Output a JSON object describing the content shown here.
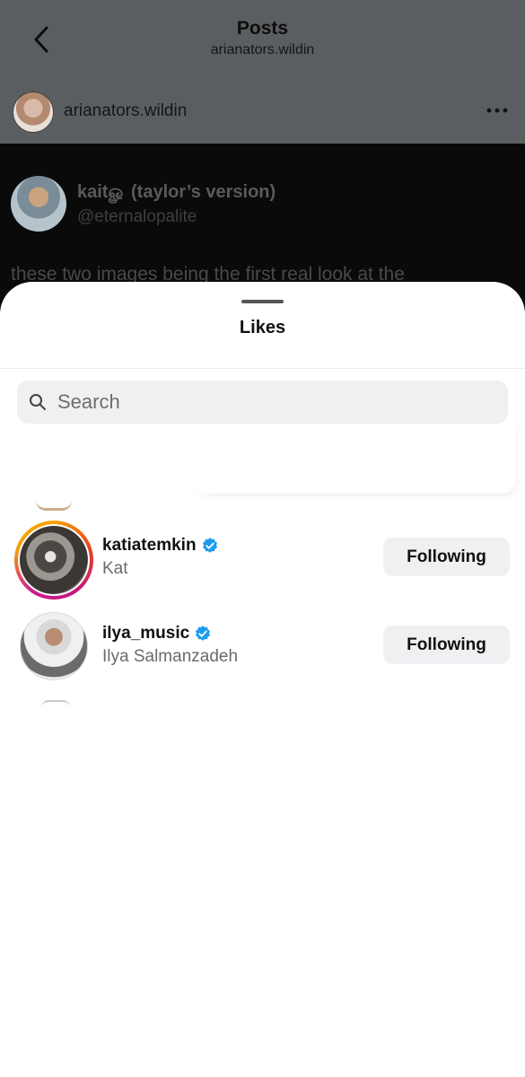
{
  "header": {
    "title": "Posts",
    "subtitle": "arianators.wildin"
  },
  "post": {
    "username": "arianators.wildin",
    "embedded_tweet": {
      "name": "kaitௐ (taylor’s version)",
      "handle": "@eternalopalite",
      "text_partial": "these two images being the first real look at the"
    }
  },
  "sheet": {
    "title": "Likes",
    "search": {
      "placeholder": "Search",
      "value": ""
    },
    "users": [
      {
        "username": "katiatemkin",
        "full_name": "Kat",
        "verified": true,
        "has_story_ring": true,
        "button_label": "Following"
      },
      {
        "username": "ilya_music",
        "full_name": "Ilya Salmanzadeh",
        "verified": true,
        "has_story_ring": false,
        "button_label": "Following"
      }
    ]
  },
  "colors": {
    "verified_blue": "#1d9bf0",
    "button_bg": "#eff0f2",
    "dim_overlay": "#5b5e61"
  }
}
